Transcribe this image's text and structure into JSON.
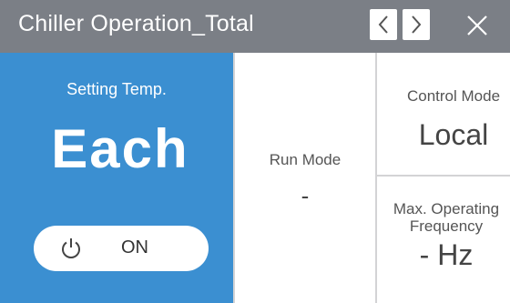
{
  "window": {
    "title": "Chiller Operation_Total",
    "prev_icon": "chevron-left-icon",
    "next_icon": "chevron-right-icon",
    "close_icon": "close-icon"
  },
  "setting": {
    "label": "Setting Temp.",
    "value": "Each"
  },
  "power": {
    "icon": "power-icon",
    "label": "ON"
  },
  "run_mode": {
    "label": "Run Mode",
    "value": "-"
  },
  "control_mode": {
    "label": "Control Mode",
    "value": "Local"
  },
  "frequency": {
    "label_line1": "Max. Operating",
    "label_line2": "Frequency",
    "value": "- Hz"
  },
  "colors": {
    "titlebar": "#7b7f86",
    "accent_blue": "#3b8fd1",
    "panel": "#ffffff",
    "divider": "#d3d3d5"
  }
}
